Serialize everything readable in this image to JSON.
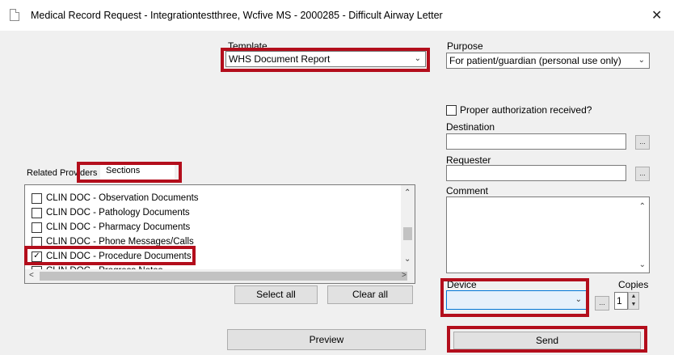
{
  "window": {
    "title": "Medical Record Request - Integrationtestthree, Wcfive  MS - 2000285 - Difficult Airway Letter",
    "close_glyph": "✕"
  },
  "template": {
    "label": "Template",
    "value": "WHS Document Report"
  },
  "purpose": {
    "label": "Purpose",
    "value": "For patient/guardian (personal use only)"
  },
  "authorization": {
    "label": "Proper authorization received?",
    "checked": false
  },
  "destination": {
    "label": "Destination",
    "value": "",
    "button": "..."
  },
  "requester": {
    "label": "Requester",
    "value": "",
    "button": "..."
  },
  "comment": {
    "label": "Comment",
    "value": ""
  },
  "tabs": [
    {
      "label": "Related Providers"
    },
    {
      "label": "Sections"
    }
  ],
  "sections": [
    {
      "label": "CLIN DOC - Observation Documents",
      "checked": false
    },
    {
      "label": "CLIN DOC - Pathology Documents",
      "checked": false
    },
    {
      "label": "CLIN DOC - Pharmacy Documents",
      "checked": false
    },
    {
      "label": "CLIN DOC - Phone Messages/Calls",
      "checked": false
    },
    {
      "label": "CLIN DOC - Procedure Documents",
      "checked": true
    },
    {
      "label": "CLIN DOC - Progress Notes",
      "checked": false
    }
  ],
  "buttons": {
    "select_all": "Select all",
    "clear_all": "Clear all",
    "preview": "Preview",
    "send": "Send"
  },
  "device": {
    "label": "Device",
    "value": "",
    "button": "..."
  },
  "copies": {
    "label": "Copies",
    "value": "1"
  },
  "colors": {
    "highlight_red": "#b30e1c",
    "dialog_bg": "#f0f0f0",
    "device_field_bg": "#e5f1fb"
  }
}
